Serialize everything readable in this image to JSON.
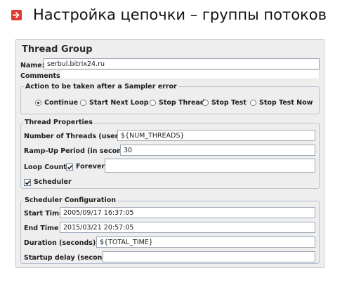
{
  "slide": {
    "title": "Настройка цепочки – группы потоков",
    "accent_color": "#e03a2f",
    "bullet_icon": "arrow-right-icon"
  },
  "panel": {
    "heading": "Thread Group",
    "name_label": "Name:",
    "name_value": "serbul.bitrix24.ru",
    "comments_label": "Comments:",
    "comments_value": ""
  },
  "sampler_error": {
    "title": "Action to be taken after a Sampler error",
    "options": [
      "Continue",
      "Start Next Loop",
      "Stop Thread",
      "Stop Test",
      "Stop Test Now"
    ],
    "selected": "Continue"
  },
  "thread_properties": {
    "title": "Thread Properties",
    "threads_label": "Number of Threads (users):",
    "threads_value": "${NUM_THREADS}",
    "rampup_label": "Ramp-Up Period (in seconds):",
    "rampup_value": "30",
    "loop_label": "Loop Count:",
    "forever_label": "Forever",
    "forever_checked": true,
    "loop_value": "",
    "scheduler_label": "Scheduler",
    "scheduler_checked": true
  },
  "scheduler": {
    "title": "Scheduler Configuration",
    "start_label": "Start Time",
    "start_value": "2005/09/17 16:37:05",
    "end_label": "End Time",
    "end_value": "2015/03/21 20:57:05",
    "duration_label": "Duration (seconds)",
    "duration_value": "${TOTAL_TIME}",
    "delay_label": "Startup delay (seconds)",
    "delay_value": ""
  }
}
